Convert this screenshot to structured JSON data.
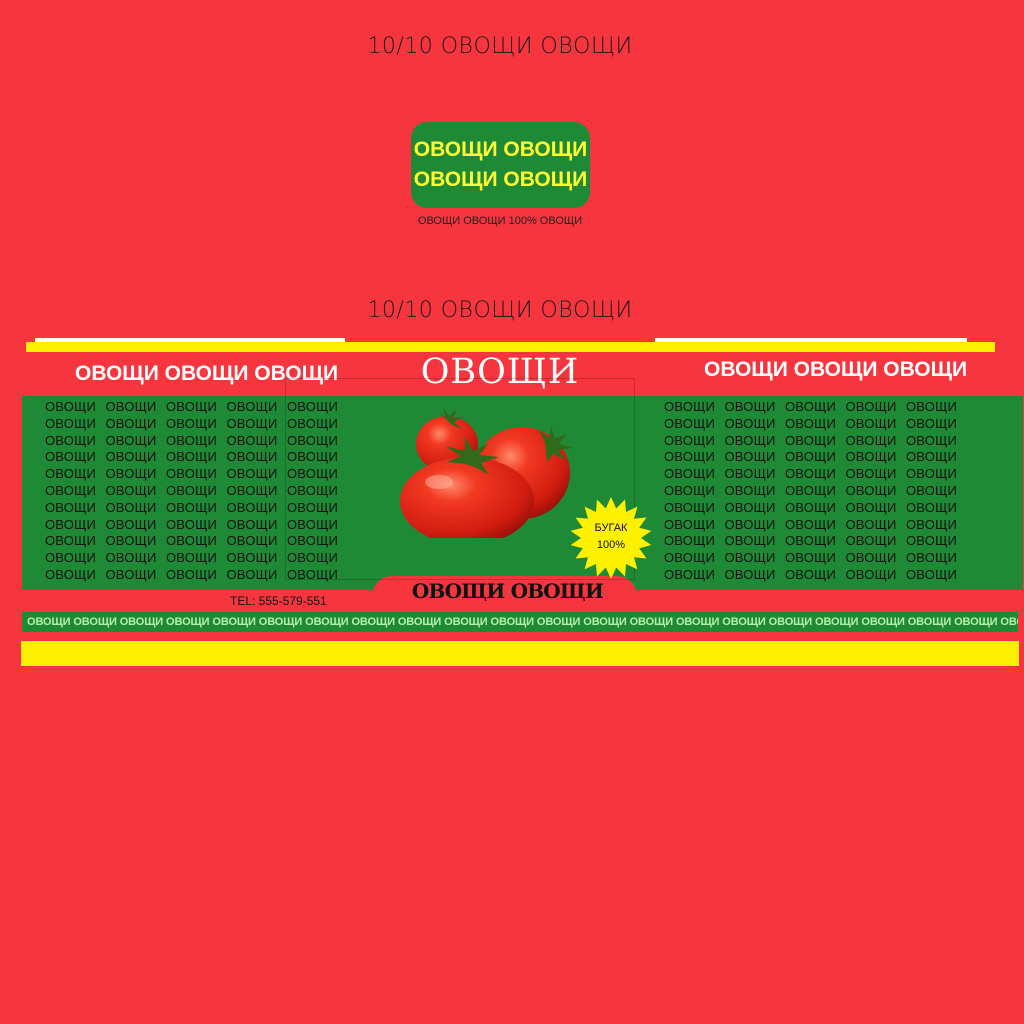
{
  "headings": {
    "top": "10/10 ОВОЩИ ОВОЩИ",
    "middle": "10/10 ОВОЩИ ОВОЩИ"
  },
  "mini_badge": {
    "line1": "ОВОЩИ ОВОЩИ",
    "line2": "ОВОЩИ ОВОЩИ",
    "caption": "ОВОЩИ ОВОЩИ 100% ОВОЩИ"
  },
  "label": {
    "main_title": "ОВОЩИ",
    "side_title_left": "ОВОЩИ ОВОЩИ ОВОЩИ",
    "side_title_right": "ОВОЩИ ОВОЩИ ОВОЩИ",
    "grid_word": "ОВОЩИ",
    "grid_rows": 11,
    "grid_cols": 5,
    "badge_line1": "БУГАК",
    "badge_line2": "100%",
    "banner": "ОВОЩИ ОВОЩИ",
    "phone": "TEL: 555-579-551",
    "ticker_word": "ОВОЩИ",
    "ticker_count": 25
  },
  "colors": {
    "background": "#f7353f",
    "green": "#1f8a36",
    "yellow": "#fff000",
    "badge_text": "#ffff33",
    "ticker_text": "#b6f0a6"
  }
}
